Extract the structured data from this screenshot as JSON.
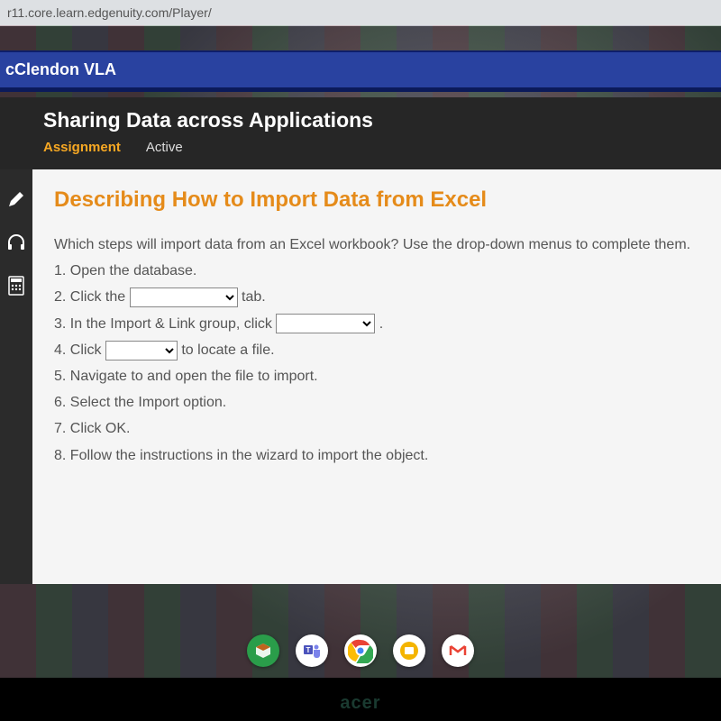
{
  "browser": {
    "url": "r11.core.learn.edgenuity.com/Player/"
  },
  "banner": {
    "school": "cClendon VLA"
  },
  "lesson": {
    "title": "Sharing Data across Applications",
    "tabs": {
      "active": "Assignment",
      "inactive": "Active"
    }
  },
  "content": {
    "heading": "Describing How to Import Data from Excel",
    "intro": "Which steps will import data from an Excel workbook? Use the drop-down menus to complete them.",
    "steps": {
      "s1": "1. Open the database.",
      "s2_pre": "2. Click the ",
      "s2_post": " tab.",
      "s3_pre": "3. In the Import & Link group, click ",
      "s3_post": ".",
      "s4_pre": "4. Click ",
      "s4_post": " to locate a file.",
      "s5": "5. Navigate to and open the file to import.",
      "s6": "6. Select the Import option.",
      "s7": "7. Click OK.",
      "s8": "8. Follow the instructions in the wizard to import the object."
    }
  },
  "dock": {
    "teams": "T",
    "gmail": "M"
  },
  "device": {
    "brand": "acer"
  }
}
